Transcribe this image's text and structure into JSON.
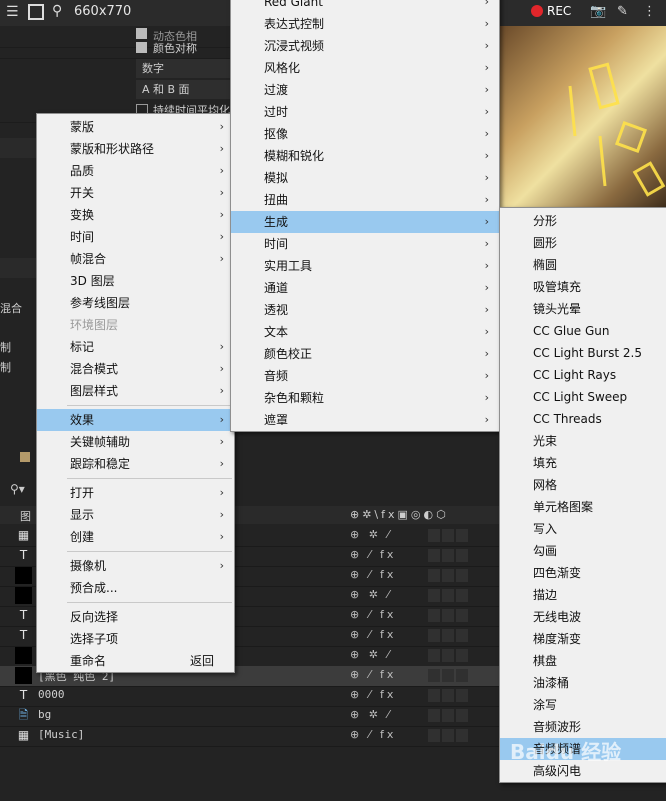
{
  "toolbar": {
    "size_label": "660x770",
    "rec_label": "REC"
  },
  "effect_controls": {
    "checkbox_1": "动态色相",
    "checkbox_2": "颜色对称",
    "dropdown_1": "数字",
    "dropdown_2": "A 和 B 面",
    "checkbox_3": "持续时间平均化",
    "side_text_1": "混合",
    "side_text_2": "制",
    "side_text_3": "制"
  },
  "timeline": {
    "col_header": "图",
    "layers": [
      {
        "icon": "comp",
        "label": ""
      },
      {
        "icon": "T",
        "label": "位置"
      },
      {
        "icon": "black",
        "label": ""
      },
      {
        "icon": "black",
        "label": ""
      },
      {
        "icon": "T",
        "label": ""
      },
      {
        "icon": "T",
        "label": "DE Remix)"
      },
      {
        "icon": "black",
        "label": ""
      },
      {
        "icon": "black",
        "label": "[黑色 纯色 2]"
      },
      {
        "icon": "T",
        "label": "0000"
      },
      {
        "icon": "file",
        "label": "bg"
      },
      {
        "icon": "comp",
        "label": "[Music]"
      }
    ]
  },
  "context_menu": {
    "items": [
      {
        "label": "蒙版",
        "submenu": true
      },
      {
        "label": "蒙版和形状路径",
        "submenu": true
      },
      {
        "label": "品质",
        "submenu": true
      },
      {
        "label": "开关",
        "submenu": true
      },
      {
        "label": "变换",
        "submenu": true
      },
      {
        "label": "时间",
        "submenu": true
      },
      {
        "label": "帧混合",
        "submenu": true
      },
      {
        "label": "3D 图层",
        "submenu": false
      },
      {
        "label": "参考线图层",
        "submenu": false
      },
      {
        "label": "环境图层",
        "submenu": false,
        "disabled": true
      },
      {
        "label": "标记",
        "submenu": true
      },
      {
        "label": "混合模式",
        "submenu": true
      },
      {
        "label": "图层样式",
        "submenu": true
      },
      {
        "separator": true
      },
      {
        "label": "效果",
        "submenu": true,
        "highlighted": true
      },
      {
        "label": "关键帧辅助",
        "submenu": true
      },
      {
        "label": "跟踪和稳定",
        "submenu": true
      },
      {
        "separator": true
      },
      {
        "label": "打开",
        "submenu": true
      },
      {
        "label": "显示",
        "submenu": true
      },
      {
        "label": "创建",
        "submenu": true
      },
      {
        "separator": true
      },
      {
        "label": "摄像机",
        "submenu": true
      },
      {
        "label": "预合成...",
        "submenu": false
      },
      {
        "separator": true
      },
      {
        "label": "反向选择",
        "submenu": false
      },
      {
        "label": "选择子项",
        "submenu": false
      },
      {
        "label": "重命名",
        "submenu": false,
        "shortcut": "返回"
      }
    ]
  },
  "effects_menu": {
    "items": [
      {
        "label": "Red Giant",
        "submenu": true
      },
      {
        "label": "表达式控制",
        "submenu": true
      },
      {
        "label": "沉浸式视频",
        "submenu": true
      },
      {
        "label": "风格化",
        "submenu": true
      },
      {
        "label": "过渡",
        "submenu": true
      },
      {
        "label": "过时",
        "submenu": true
      },
      {
        "label": "抠像",
        "submenu": true
      },
      {
        "label": "模糊和锐化",
        "submenu": true
      },
      {
        "label": "模拟",
        "submenu": true
      },
      {
        "label": "扭曲",
        "submenu": true
      },
      {
        "label": "生成",
        "submenu": true,
        "highlighted": true
      },
      {
        "label": "时间",
        "submenu": true
      },
      {
        "label": "实用工具",
        "submenu": true
      },
      {
        "label": "通道",
        "submenu": true
      },
      {
        "label": "透视",
        "submenu": true
      },
      {
        "label": "文本",
        "submenu": true
      },
      {
        "label": "颜色校正",
        "submenu": true
      },
      {
        "label": "音频",
        "submenu": true
      },
      {
        "label": "杂色和颗粒",
        "submenu": true
      },
      {
        "label": "遮罩",
        "submenu": true
      }
    ]
  },
  "generate_menu": {
    "items": [
      {
        "label": "分形"
      },
      {
        "label": "圆形"
      },
      {
        "label": "椭圆"
      },
      {
        "label": "吸管填充"
      },
      {
        "label": "镜头光晕"
      },
      {
        "label": "CC Glue Gun"
      },
      {
        "label": "CC Light Burst 2.5"
      },
      {
        "label": "CC Light Rays"
      },
      {
        "label": "CC Light Sweep"
      },
      {
        "label": "CC Threads"
      },
      {
        "label": "光束"
      },
      {
        "label": "填充"
      },
      {
        "label": "网格"
      },
      {
        "label": "单元格图案"
      },
      {
        "label": "写入"
      },
      {
        "label": "勾画"
      },
      {
        "label": "四色渐变"
      },
      {
        "label": "描边"
      },
      {
        "label": "无线电波"
      },
      {
        "label": "梯度渐变"
      },
      {
        "label": "棋盘"
      },
      {
        "label": "油漆桶"
      },
      {
        "label": "涂写"
      },
      {
        "label": "音频波形"
      },
      {
        "label": "音频频谱",
        "highlighted": true
      },
      {
        "label": "高级闪电"
      }
    ]
  },
  "watermark": "Baidu 经验"
}
